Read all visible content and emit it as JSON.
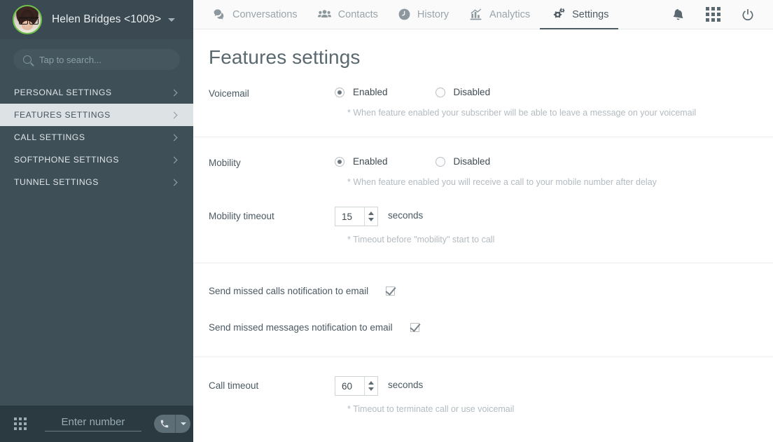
{
  "sidebar": {
    "user_name": "Helen Bridges <1009>",
    "avatar_alt": "user-avatar",
    "search_placeholder": "Tap to search...",
    "menu": [
      {
        "label": "PERSONAL SETTINGS",
        "active": false
      },
      {
        "label": "FEATURES SETTINGS",
        "active": true
      },
      {
        "label": "CALL SETTINGS",
        "active": false
      },
      {
        "label": "SOFTPHONE SETTINGS",
        "active": false
      },
      {
        "label": "TUNNEL SETTINGS",
        "active": false
      }
    ],
    "dialer": {
      "number_placeholder": "Enter number",
      "number_value": ""
    }
  },
  "topnav": {
    "tabs": [
      {
        "label": "Conversations",
        "icon": "chat-icon",
        "active": false
      },
      {
        "label": "Contacts",
        "icon": "contacts-icon",
        "active": false
      },
      {
        "label": "History",
        "icon": "clock-icon",
        "active": false
      },
      {
        "label": "Analytics",
        "icon": "chart-icon",
        "active": false
      },
      {
        "label": "Settings",
        "icon": "gears-icon",
        "active": true
      }
    ],
    "right_icons": [
      "bell-icon",
      "apps-grid-icon",
      "power-icon"
    ]
  },
  "page": {
    "title": "Features settings"
  },
  "settings": {
    "voicemail": {
      "label": "Voicemail",
      "enabled_label": "Enabled",
      "disabled_label": "Disabled",
      "selected": "Enabled",
      "hint": "* When feature enabled your subscriber will be able to leave a message on your voicemail"
    },
    "mobility": {
      "label": "Mobility",
      "enabled_label": "Enabled",
      "disabled_label": "Disabled",
      "selected": "Enabled",
      "hint": "* When feature enabled you will receive a call to your mobile number after delay"
    },
    "mobility_timeout": {
      "label": "Mobility timeout",
      "value": "15",
      "unit": "seconds",
      "hint": "* Timeout before \"mobility\" start to call"
    },
    "missed_calls_email": {
      "label": "Send missed calls notification to email",
      "checked": true
    },
    "missed_messages_email": {
      "label": "Send missed messages notification to email",
      "checked": true
    },
    "call_timeout": {
      "label": "Call timeout",
      "value": "60",
      "unit": "seconds",
      "hint": "* Timeout to terminate call or use voicemail"
    }
  },
  "colors": {
    "sidebar_bg": "#3f4f57",
    "sidebar_header_bg": "#3b4a52",
    "sidebar_bottom_bg": "#2b3940",
    "active_item_bg": "#dde2e5",
    "accent_ring": "#6cc24a",
    "topnav_bg": "#fafafa",
    "text_dark": "#4a5962",
    "hint_text": "#b3bbc0"
  }
}
